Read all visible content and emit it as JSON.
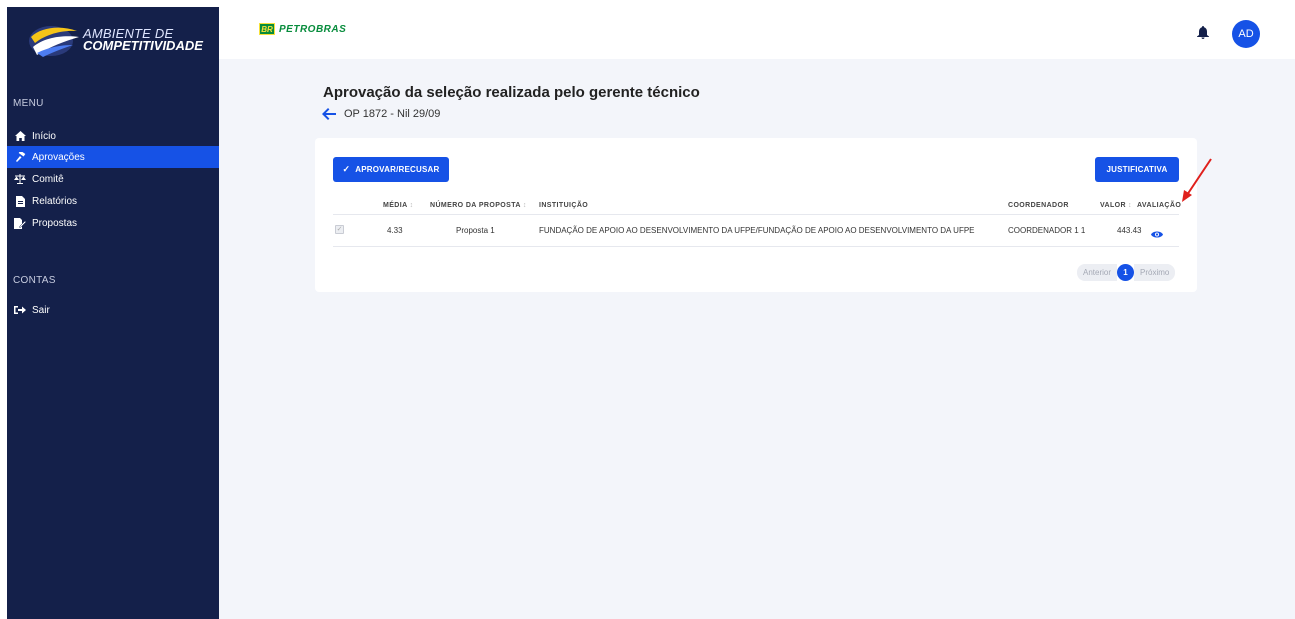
{
  "logo": {
    "line1": "AMBIENTE DE",
    "line2": "COMPETITIVIDADE"
  },
  "sidebar": {
    "menu_label": "MENU",
    "items": [
      {
        "label": "Início",
        "icon": "home-icon",
        "active": false
      },
      {
        "label": "Aprovações",
        "icon": "gavel-icon",
        "active": true
      },
      {
        "label": "Comitê",
        "icon": "balance-scale-icon",
        "active": false
      },
      {
        "label": "Relatórios",
        "icon": "file-icon",
        "active": false
      },
      {
        "label": "Propostas",
        "icon": "edit-file-icon",
        "active": false
      }
    ],
    "accounts_label": "CONTAS",
    "logout_label": "Sair"
  },
  "topbar": {
    "brand_badge": "BR",
    "brand_name": "PETROBRAS",
    "avatar_initials": "AD"
  },
  "page": {
    "title": "Aprovação da seleção realizada pelo gerente técnico",
    "subtitle": "OP 1872 - Nil 29/09"
  },
  "toolbar": {
    "approve_label": "APROVAR/RECUSAR",
    "justify_label": "JUSTIFICATIVA"
  },
  "table": {
    "headers": {
      "media": "MÉDIA",
      "numero": "NÚMERO DA PROPOSTA",
      "instituicao": "INSTITUIÇÃO",
      "coordenador": "COORDENADOR",
      "valor": "VALOR",
      "avaliacao": "AVALIAÇÃO"
    },
    "sort_glyph": "↕",
    "rows": [
      {
        "media": "4.33",
        "numero": "Proposta 1",
        "instituicao": "FUNDAÇÃO DE APOIO AO DESENVOLVIMENTO DA UFPE/FUNDAÇÃO DE APOIO AO DESENVOLVIMENTO DA UFPE",
        "coordenador": "COORDENADOR 1 1",
        "valor": "443.43"
      }
    ]
  },
  "pagination": {
    "prev": "Anterior",
    "current": "1",
    "next": "Próximo"
  },
  "colors": {
    "sidebar": "#14204a",
    "accent": "#1652e6",
    "background": "#f3f5fa",
    "annotation": "#e0201c"
  }
}
